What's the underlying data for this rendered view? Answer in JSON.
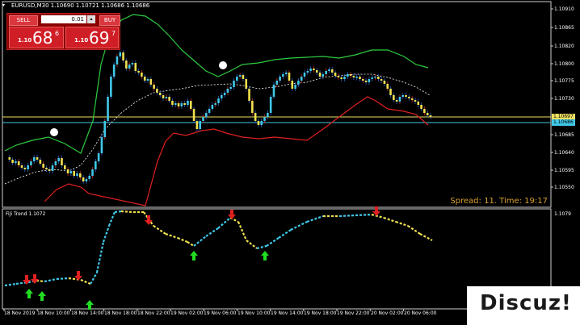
{
  "window": {
    "symbol_line": "EURUSD,M30  1.10690 1.10721 1.10686 1.10686",
    "collapse_glyph": "▾"
  },
  "trade_panel": {
    "sell_label": "SELL",
    "buy_label": "BUY",
    "lot_value": "0.01",
    "spin_down": "▾",
    "spin_up": "▴",
    "sell_prefix": "1.10",
    "sell_big": "68",
    "sell_sup": "6",
    "buy_prefix": "1.10",
    "buy_big": "69",
    "buy_sup": "7"
  },
  "spread_text": "Spread: 11. Time: 19:17",
  "price_axis": [
    "1.10910",
    "1.10865",
    "1.10820",
    "1.10800",
    "1.10775",
    "1.10730",
    "1.10685",
    "1.10640",
    "1.10595",
    "1.10550"
  ],
  "price_tags": {
    "ask": "1.10697",
    "bid": "1.10686"
  },
  "subwindow": {
    "title": "FiJi Trend 1.1072",
    "axis_label": "1.1079"
  },
  "time_axis": [
    "18 Nov 2019",
    "18 Nov 10:00",
    "18 Nov 14:00",
    "18 Nov 18:00",
    "18 Nov 22:00",
    "19 Nov 02:00",
    "19 Nov 06:00",
    "19 Nov 10:00",
    "19 Nov 14:00",
    "19 Nov 18:00",
    "19 Nov 22:00",
    "20 Nov 02:00",
    "20 Nov 06:00"
  ],
  "watermark": "Discuz!",
  "colors": {
    "background": "#000000",
    "bull_candle": "#40c8e8",
    "bear_candle": "#f0e050",
    "upper_band": "#2ecc40",
    "lower_band": "#e02020",
    "mid_line": "#ffffff",
    "ask_line": "#f0e060",
    "bid_line": "#40c8e8",
    "spread_text": "#d8a030",
    "down_arrow": "#e02020",
    "up_arrow": "#22dd22"
  }
}
